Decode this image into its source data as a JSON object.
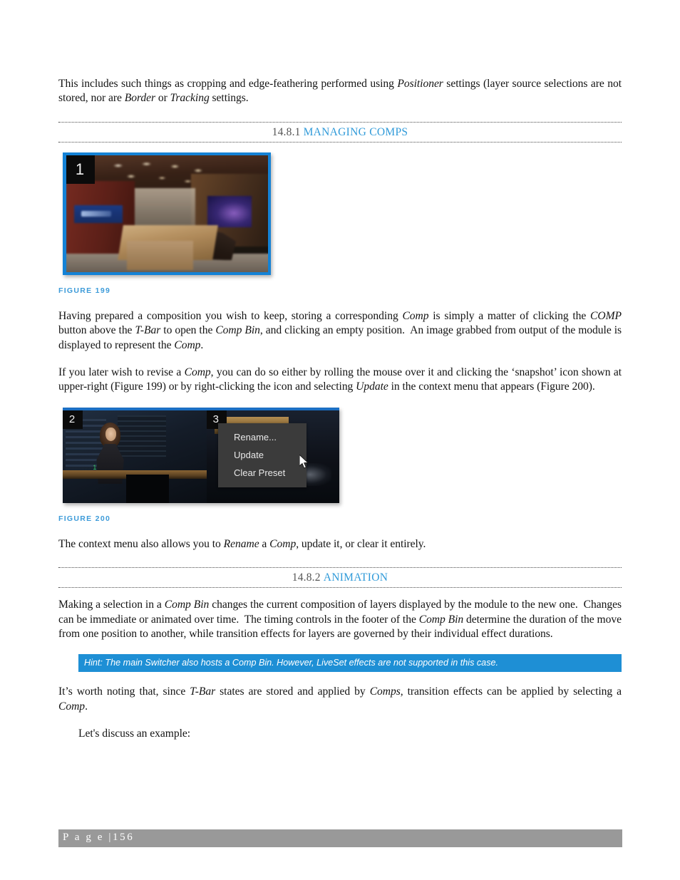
{
  "document": {
    "paragraphs": {
      "intro": "This includes such things as cropping and edge-feathering performed using Positioner settings (layer source selections are not stored, nor are Border or Tracking settings.",
      "p_storing": "Having prepared a composition you wish to keep, storing a corresponding Comp is simply a matter of clicking the COMP button above the T-Bar to open the Comp Bin, and clicking an empty position.  An image grabbed from output of the module is displayed to represent the Comp.",
      "p_revise": "If you later wish to revise a Comp, you can do so either by rolling the mouse over it and clicking the 'snapshot' icon shown at upper-right (Figure 199) or by right-clicking the icon and selecting Update in the context menu that appears (Figure 200).",
      "p_contextmenu": "The context menu also allows you to Rename a Comp, update it, or clear it entirely.",
      "p_animation": "Making a selection in a Comp Bin changes the current composition of layers displayed by the module to the new one.  Changes can be immediate or animated over time.  The timing controls in the footer of the Comp Bin determine the duration of the move from one position to another, while transition effects for layers are governed by their individual effect durations.",
      "p_tbar": "It's worth noting that, since T-Bar states are stored and applied by Comps, transition effects can be applied by selecting a Comp.",
      "p_example": "Let's discuss an example:"
    },
    "sections": [
      {
        "number": "14.8.1",
        "title": "MANAGING COMPS"
      },
      {
        "number": "14.8.2",
        "title": "ANIMATION"
      }
    ],
    "figures": [
      {
        "caption": "FIGURE 199",
        "tile_numbers": [
          "1"
        ]
      },
      {
        "caption": "FIGURE 200",
        "tile_numbers": [
          "2",
          "3"
        ]
      }
    ],
    "context_menu": {
      "items": [
        "Rename...",
        "Update",
        "Clear Preset"
      ]
    },
    "hint": "Hint: The main Switcher also hosts a Comp Bin.  However, LiveSet effects are not supported in this case.",
    "footer": {
      "page_label": "P a g e",
      "separator": "|",
      "page_number": "156",
      "full": "P a g e  |  156"
    },
    "colors": {
      "heading_blue": "#2f9ad9",
      "caption_blue": "#3d9bd9",
      "hint_background": "#1e8fd5",
      "footer_background": "#999999",
      "figure_border_blue": "#1482d6"
    }
  }
}
